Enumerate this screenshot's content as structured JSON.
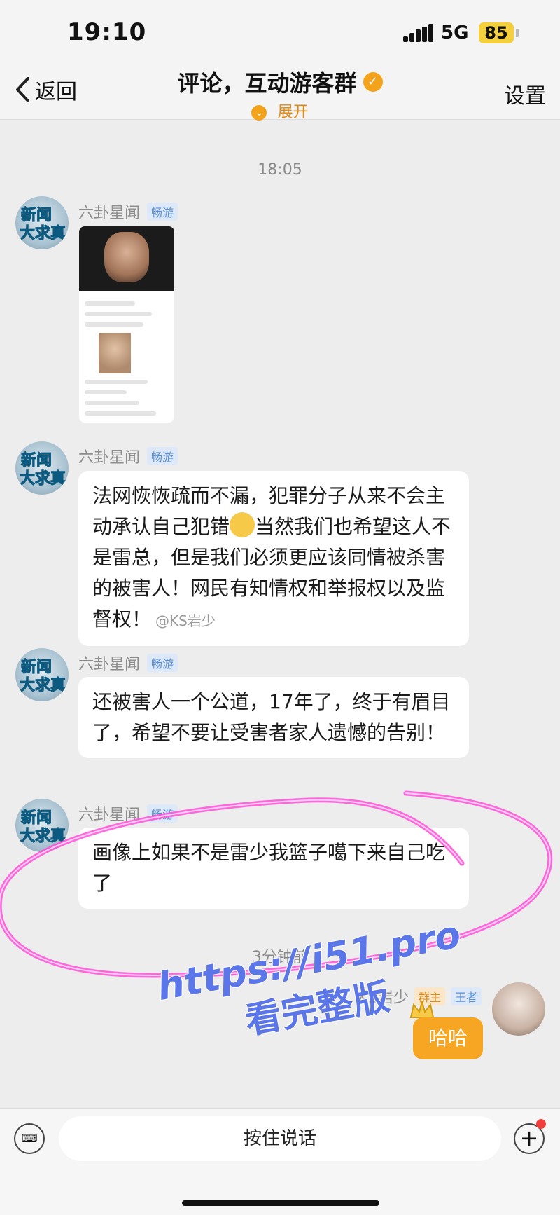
{
  "status_bar": {
    "time": "19:10",
    "network": "5G",
    "battery": "85"
  },
  "nav": {
    "back_label": "返回",
    "title": "评论，互动游客群",
    "subtitle": "展开",
    "settings_label": "设置"
  },
  "messages": [
    {
      "time": "18:05"
    },
    {
      "sender": "六卦星闻",
      "tag": "畅游",
      "type": "image"
    },
    {
      "sender": "六卦星闻",
      "tag": "畅游",
      "text_before_emoji": "法网恢恢疏而不漏，犯罪分子从来不会主动承认自己犯错",
      "text_after_emoji": "当然我们也希望这人不是雷总，但是我们必须更应该同情被杀害的被害人！网民有知情权和举报权以及监督权！",
      "watermark": "@KS岩少"
    },
    {
      "sender": "六卦星闻",
      "tag": "畅游",
      "text": "还被害人一个公道，17年了，终于有眉目了，希望不要让受害者家人遗憾的告别！"
    },
    {
      "sender": "六卦星闻",
      "tag": "畅游",
      "text": "画像上如果不是雷少我篮子噶下来自己吃了"
    },
    {
      "time": "3分钟前"
    },
    {
      "sender": "KS岩少",
      "role_owner": "群主",
      "role_rank": "王者",
      "text": "哈哈"
    }
  ],
  "overlay_watermark": {
    "line1": "https://i51.pro",
    "line2": "看完整版"
  },
  "input_bar": {
    "voice_label": "按住说话"
  },
  "colors": {
    "accent": "#f6a623",
    "tag_blue": "#5a8fd6",
    "highlight": "#ff4fd8"
  }
}
